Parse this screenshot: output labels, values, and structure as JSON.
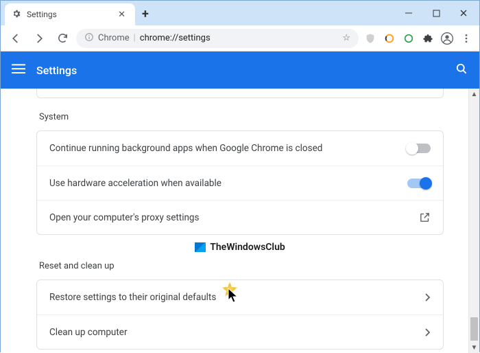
{
  "tab": {
    "title": "Settings"
  },
  "omnibox": {
    "scheme_label": "Chrome",
    "url_text": "chrome://settings"
  },
  "header": {
    "title": "Settings"
  },
  "sections": {
    "system": {
      "label": "System",
      "rows": [
        {
          "text": "Continue running background apps when Google Chrome is closed",
          "toggle": "off"
        },
        {
          "text": "Use hardware acceleration when available",
          "toggle": "on"
        },
        {
          "text": "Open your computer's proxy settings",
          "action": "external"
        }
      ]
    },
    "reset": {
      "label": "Reset and clean up",
      "rows": [
        {
          "text": "Restore settings to their original defaults",
          "action": "chevron"
        },
        {
          "text": "Clean up computer",
          "action": "chevron"
        }
      ]
    }
  },
  "watermark": {
    "text": "TheWindowsClub"
  }
}
